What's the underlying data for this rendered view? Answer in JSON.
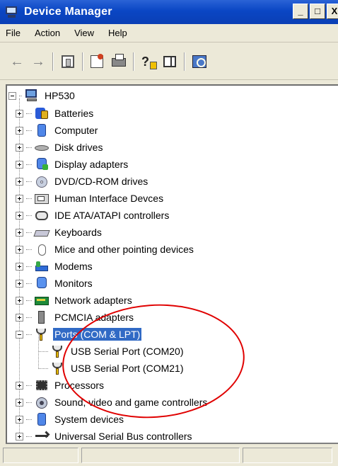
{
  "window": {
    "title": "Device Manager",
    "controls": {
      "minimize": "_",
      "maximize": "□",
      "close": "X"
    }
  },
  "menu": [
    "File",
    "Action",
    "View",
    "Help"
  ],
  "toolbar": {
    "buttons": [
      "back-arrow",
      "forward-arrow",
      "console-tree",
      "properties",
      "print",
      "help",
      "show-hide-pane",
      "scan-hardware"
    ]
  },
  "tree": {
    "root": "HP530",
    "categories": [
      {
        "label": "Batteries",
        "icon": "battery-icon"
      },
      {
        "label": "Computer",
        "icon": "computer-icon"
      },
      {
        "label": "Disk drives",
        "icon": "disk-drive-icon"
      },
      {
        "label": "Display adapters",
        "icon": "display-adapter-icon"
      },
      {
        "label": "DVD/CD-ROM drives",
        "icon": "dvd-drive-icon"
      },
      {
        "label": "Human Interface Devces",
        "icon": "hid-icon"
      },
      {
        "label": "IDE ATA/ATAPI controllers",
        "icon": "ide-controller-icon"
      },
      {
        "label": "Keyboards",
        "icon": "keyboard-icon"
      },
      {
        "label": "Mice and other pointing devices",
        "icon": "mouse-icon"
      },
      {
        "label": "Modems",
        "icon": "modem-icon"
      },
      {
        "label": "Monitors",
        "icon": "monitor-icon"
      },
      {
        "label": "Network adapters",
        "icon": "network-adapter-icon"
      },
      {
        "label": "PCMCIA adapters",
        "icon": "pcmcia-icon"
      },
      {
        "label": "Ports (COM & LPT)",
        "icon": "port-icon",
        "expanded": true,
        "selected": true
      },
      {
        "label": "Processors",
        "icon": "processor-icon"
      },
      {
        "label": "Sound, video and game controllers",
        "icon": "sound-icon"
      },
      {
        "label": "System devices",
        "icon": "system-device-icon"
      },
      {
        "label": "Universal Serial Bus controllers",
        "icon": "usb-icon"
      }
    ],
    "ports_children": [
      {
        "label": "USB Serial Port (COM20)",
        "icon": "port-icon"
      },
      {
        "label": "USB Serial Port (COM21)",
        "icon": "port-icon"
      }
    ]
  },
  "colors": {
    "titlebar": "#0a46c4",
    "selection": "#316ac5",
    "highlight_circle": "#e00000"
  }
}
